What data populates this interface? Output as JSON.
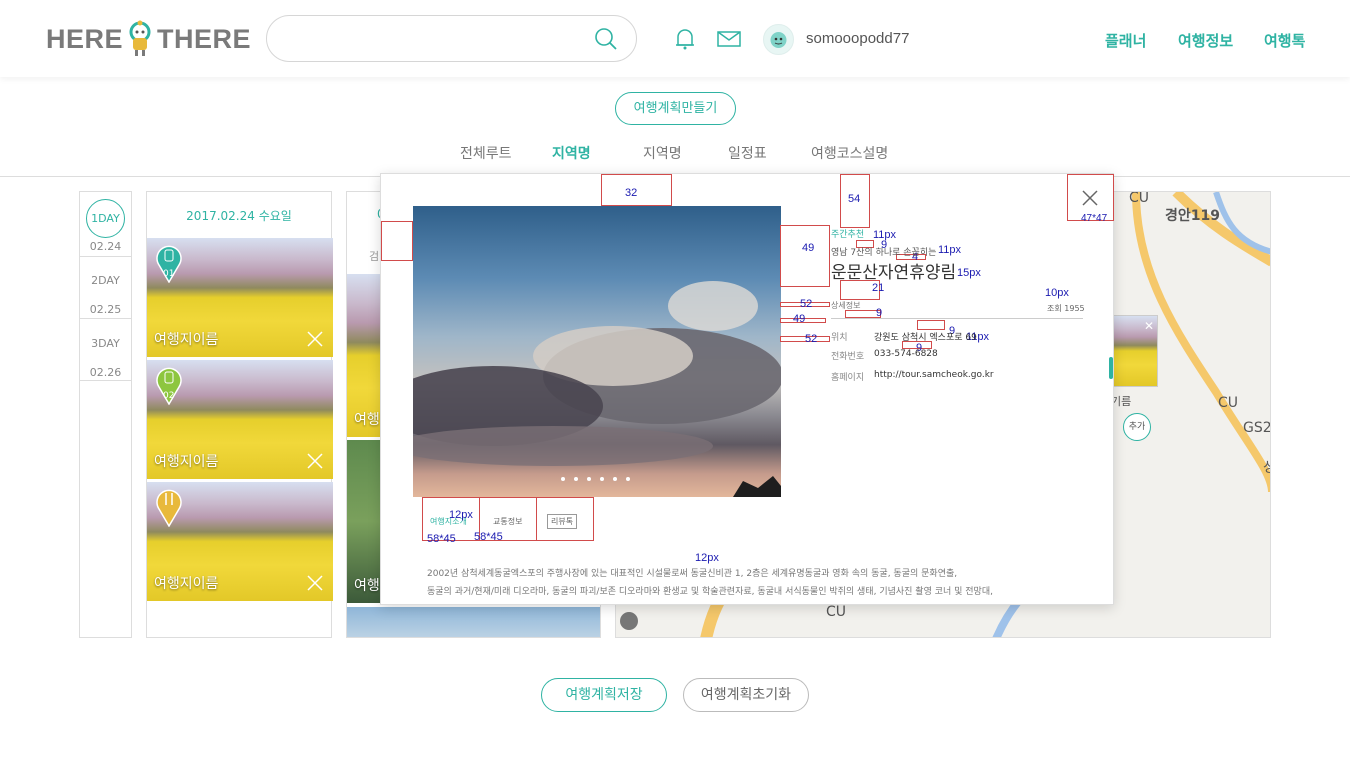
{
  "brand": {
    "left": "HERE",
    "right": "THERE",
    "accent": "#2fb3a3"
  },
  "search": {
    "value": "",
    "placeholder": "",
    "icon": "search-icon"
  },
  "user": {
    "name": "somooopodd77"
  },
  "nav": [
    {
      "label": "플래너"
    },
    {
      "label": "여행정보"
    },
    {
      "label": "여행톡"
    }
  ],
  "make_plan_label": "여행계획만들기",
  "tabs": [
    {
      "label": "전체루트",
      "active": false
    },
    {
      "label": "지역명",
      "active": true
    },
    {
      "label": "지역명",
      "active": false
    },
    {
      "label": "일정표",
      "active": false
    },
    {
      "label": "여행코스설명",
      "active": false
    }
  ],
  "days": [
    {
      "label": "1DAY",
      "date": "02.24",
      "active": true
    },
    {
      "label": "2DAY",
      "date": "02.25",
      "active": false
    },
    {
      "label": "3DAY",
      "date": "02.26",
      "active": false
    }
  ],
  "plan": {
    "date": "2017.02.24 수요일",
    "cards": [
      {
        "label": "여행지이름",
        "pin": "01"
      },
      {
        "label": "여행지이름",
        "pin": "02"
      },
      {
        "label": "여행지이름",
        "pin": ""
      }
    ]
  },
  "col2": {
    "date_partial": "0",
    "cards": [
      {
        "label": "여행"
      },
      {
        "label": "여행"
      }
    ],
    "partial_text": "검"
  },
  "map": {
    "labels": [
      "CU",
      "경안119",
      "CU",
      "GS2",
      "CU",
      "성"
    ],
    "add_label": "추가",
    "place_partial": "기름"
  },
  "modal": {
    "category": "주간추천",
    "subtitle": "영남 7산의 하나로 손꼽히는",
    "title": "운문산자연휴양림",
    "views": "조회 1955",
    "detail_heading": "상세정보",
    "info": [
      {
        "label": "위치",
        "value": "강원도 삼척시 엑스포로 69"
      },
      {
        "label": "전화번호",
        "value": "033-574-6828"
      },
      {
        "label": "홈페이지",
        "value": "http://tour.samcheok.go.kr"
      }
    ],
    "subtabs": [
      {
        "label": "여행지소개"
      },
      {
        "label": "교통정보"
      },
      {
        "label": "리뷰톡"
      }
    ],
    "description": [
      "2002년 삼척세계동굴엑스포의 주행사장에 있는 대표적인 시설물로써 동굴신비관 1, 2층은 세계유명동굴과 영화 속의 동굴, 동굴의 문화연출,",
      "동굴의 과거/현재/미래 디오라마, 동굴의 파괴/보존 디오라마와 환생교 및 학술관련자료, 동굴내 서식동물인 박쥐의 생태, 기념사진 촬영 코너 및 전망대,"
    ],
    "slide_count": 6,
    "annotations": {
      "top_gap": "32",
      "right_gap": "54",
      "close_size": "47*47",
      "a49": "49",
      "a11a": "11px",
      "a9a": "9",
      "a11b": "11px",
      "a4": "4",
      "a15": "15px",
      "a21": "21",
      "a10": "10px",
      "a52a": "52",
      "a9b": "9",
      "a49b": "49",
      "a9c": "9",
      "a11c": "11px",
      "a52b": "52",
      "a9d": "9",
      "a12a": "12px",
      "a58a": "58*45",
      "a58b": "58*45",
      "a12b": "12px"
    }
  },
  "footer": {
    "save_label": "여행계획저장",
    "reset_label": "여행계획초기화"
  }
}
